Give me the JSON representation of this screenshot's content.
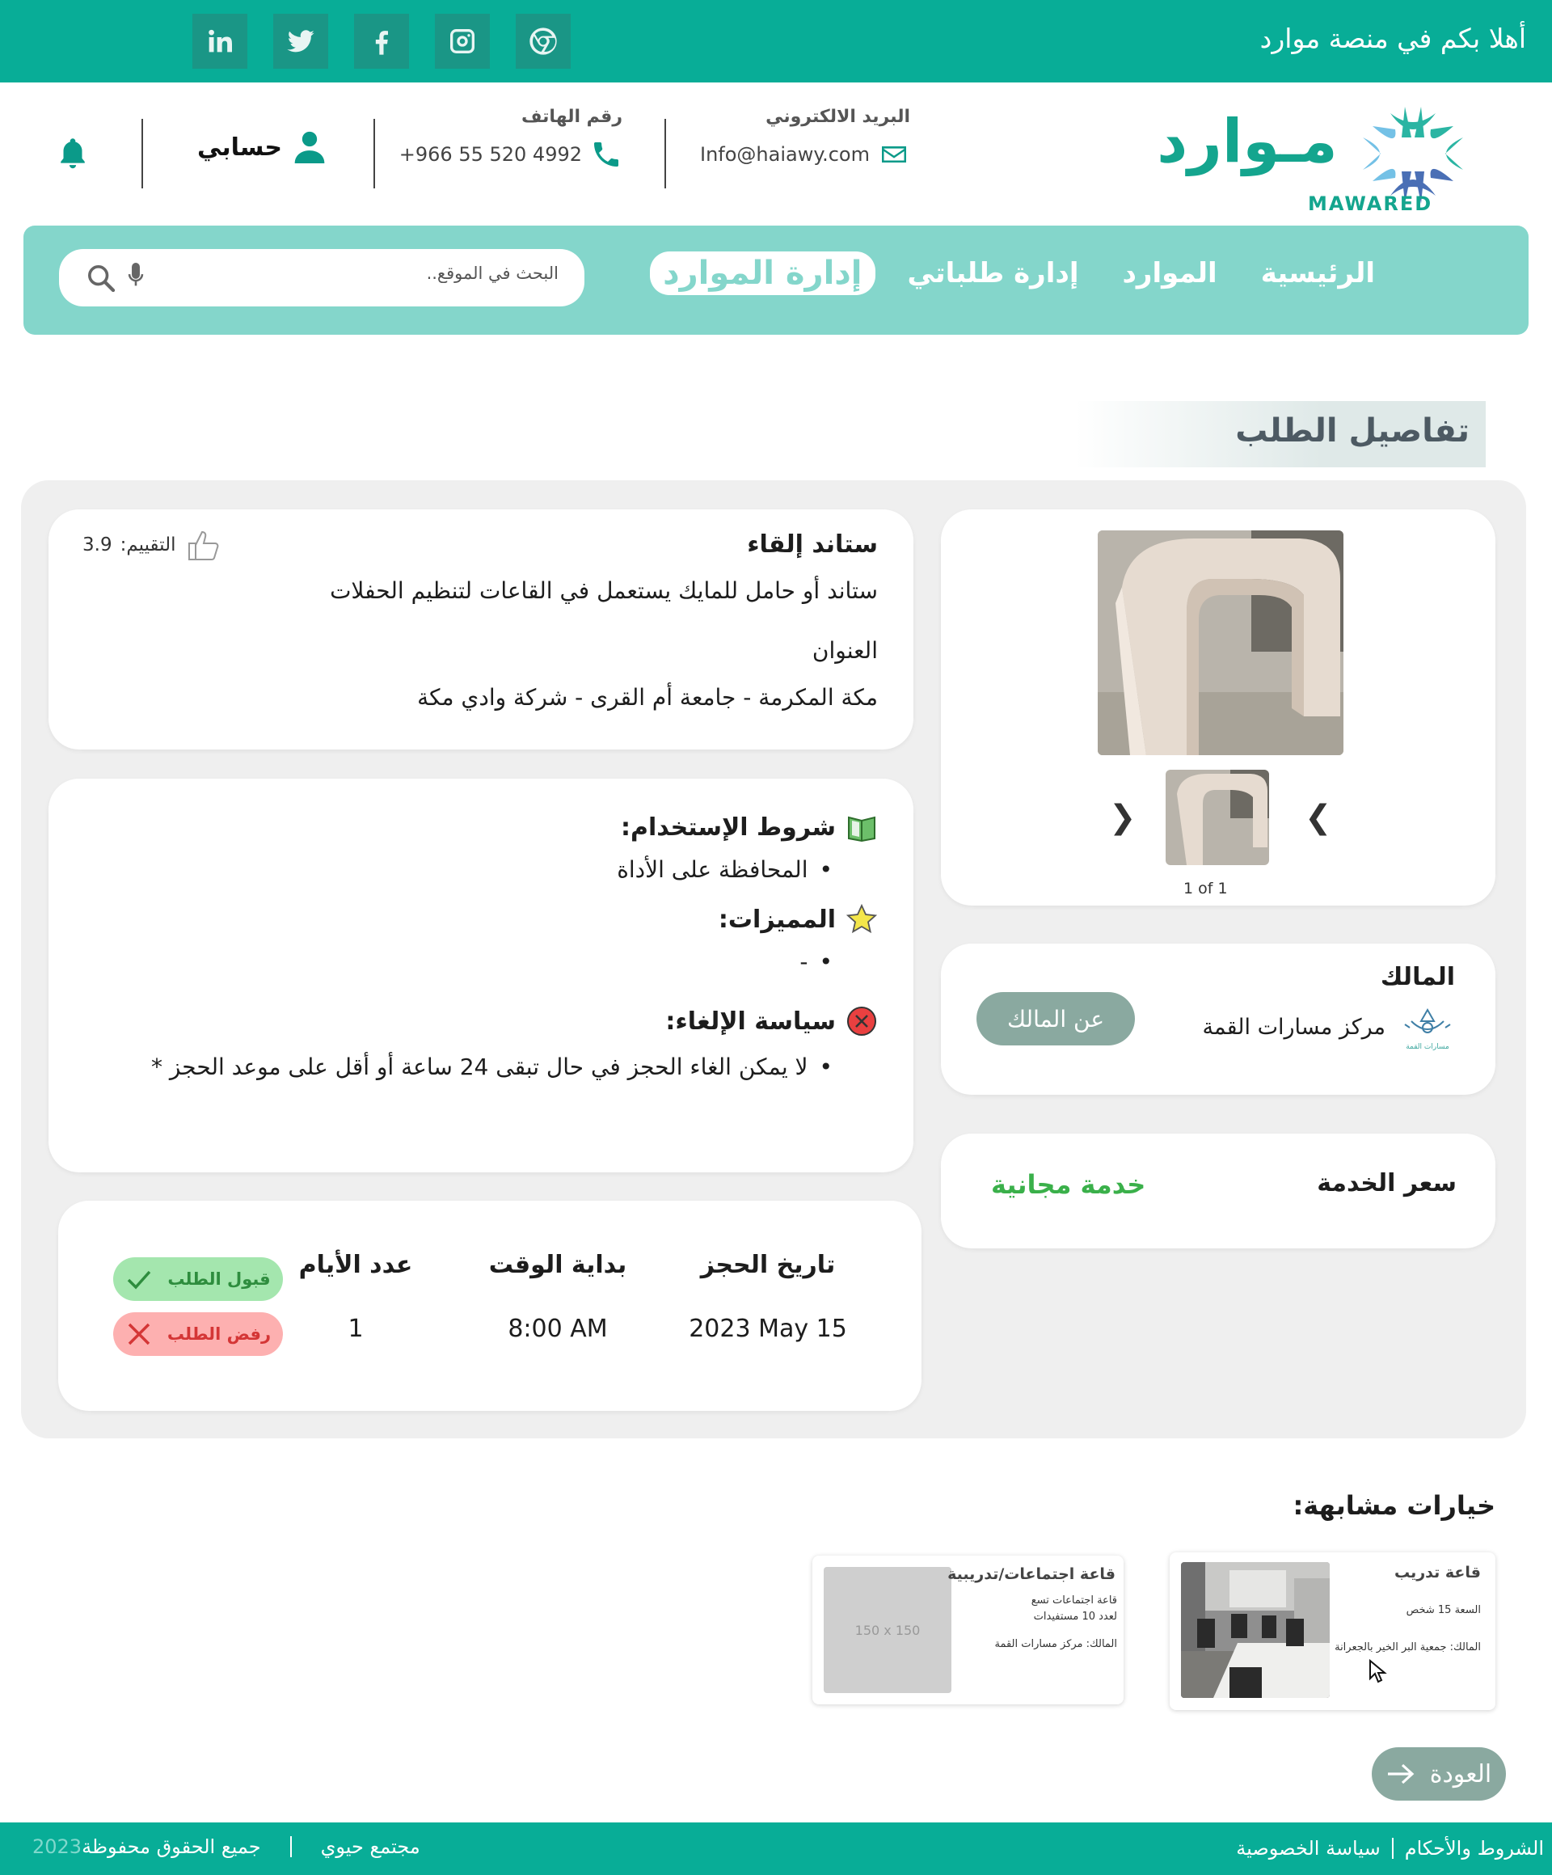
{
  "topbar": {
    "welcome": "أهلا بكم في منصة موارد",
    "socials": [
      "linkedin-icon",
      "twitter-icon",
      "facebook-icon",
      "instagram-icon",
      "chrome-icon"
    ]
  },
  "brand": {
    "name_ar": "مـوارد",
    "name_en": "MAWARED"
  },
  "header": {
    "email_label": "البريد الالكتروني",
    "email_value": "Info@haiawy.com",
    "phone_label": "رقم الهاتف",
    "phone_value": "+966 55 520 4992",
    "account": "حسابي"
  },
  "nav": {
    "items": [
      "الرئيسية",
      "الموارد",
      "إدارة طلباتي",
      "إدارة الموارد"
    ],
    "active": "إدارة الموارد",
    "search_placeholder": "البحث في الموقع.."
  },
  "page_title": "تفاصيل الطلب",
  "product": {
    "name": "ستاند إلقاء",
    "description": "ستاند أو حامل للمايك يستعمل في القاعات لتنظيم الحفلات",
    "address_label": "العنوان",
    "address": "مكة المكرمة - جامعة أم القرى - شركة وادي مكة",
    "rating_label": "التقييم:",
    "rating_value": "3.9"
  },
  "gallery": {
    "counter": "1 of 1"
  },
  "owner": {
    "title": "المالك",
    "name": "مركز مسارات القمة",
    "logo_caption": "مسارات القمة",
    "about_button": "عن المالك"
  },
  "price": {
    "label": "سعر الخدمة",
    "value": "خدمة مجانية",
    "value_color": "#3ab04a"
  },
  "terms": {
    "usage_title": "شروط الإستخدام:",
    "usage_items": [
      "المحافظة على الأداة"
    ],
    "features_title": "المميزات:",
    "features_items": [
      "-"
    ],
    "cancel_title": "سياسة الإلغاء:",
    "cancel_items": [
      "لا يمكن الغاء الحجز في حال تبقى 24 ساعة أو أقل على موعد الحجز *"
    ]
  },
  "booking": {
    "date_label": "تاريخ الحجز",
    "date_value": "2023 May 15",
    "time_label": "بداية الوقت",
    "time_value": "8:00 AM",
    "days_label": "عدد الأيام",
    "days_value": "1",
    "accept": "قبول الطلب",
    "reject": "رفض الطلب"
  },
  "similar": {
    "title": "خيارات مشابهة:",
    "cards": [
      {
        "title": "قاعة تدريب",
        "capacity": "السعة 15 شخص",
        "owner": "المالك: جمعية البر الخير بالجعرانة"
      },
      {
        "title": "قاعة اجتماعات/تدريبية",
        "desc_line1": "قاعة اجتماعات تسع",
        "desc_line2": "لعدد 10 مستفيدات",
        "owner": "المالك: مركز مسارات القمة",
        "placeholder": "150 x 150"
      }
    ]
  },
  "back_button": "العودة",
  "footer": {
    "terms": "الشروط والأحكام",
    "privacy": "سياسة الخصوصية",
    "community": "مجتمع حيوي",
    "rights": "جميع الحقوق محفوظة",
    "year": "2023"
  },
  "colors": {
    "primary": "#08ad97",
    "nav_bg": "#84d6cb",
    "accept_bg": "#a4e6ae",
    "reject_bg": "#fdb0b0",
    "muted_btn": "#8aa9a0"
  }
}
